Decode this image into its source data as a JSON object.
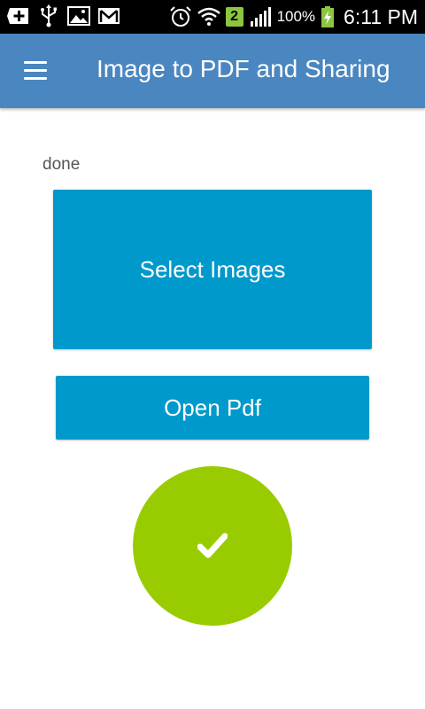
{
  "status_bar": {
    "notification_count": "2",
    "battery_percent": "100%",
    "time": "6:11 PM",
    "icons": [
      "add-icon",
      "usb-icon",
      "image-icon",
      "gmail-icon",
      "alarm-icon",
      "wifi-icon",
      "signal-icon",
      "battery-charging-icon"
    ]
  },
  "app_bar": {
    "title": "Image to PDF and Sharing",
    "background": "#4a86c0",
    "menu_icon": "hamburger-menu-icon"
  },
  "main": {
    "status_text": "done",
    "select_images_label": "Select Images",
    "open_pdf_label": "Open Pdf",
    "button_color": "#0099cc",
    "done_button_color": "#99cc00",
    "done_icon": "checkmark-icon"
  }
}
